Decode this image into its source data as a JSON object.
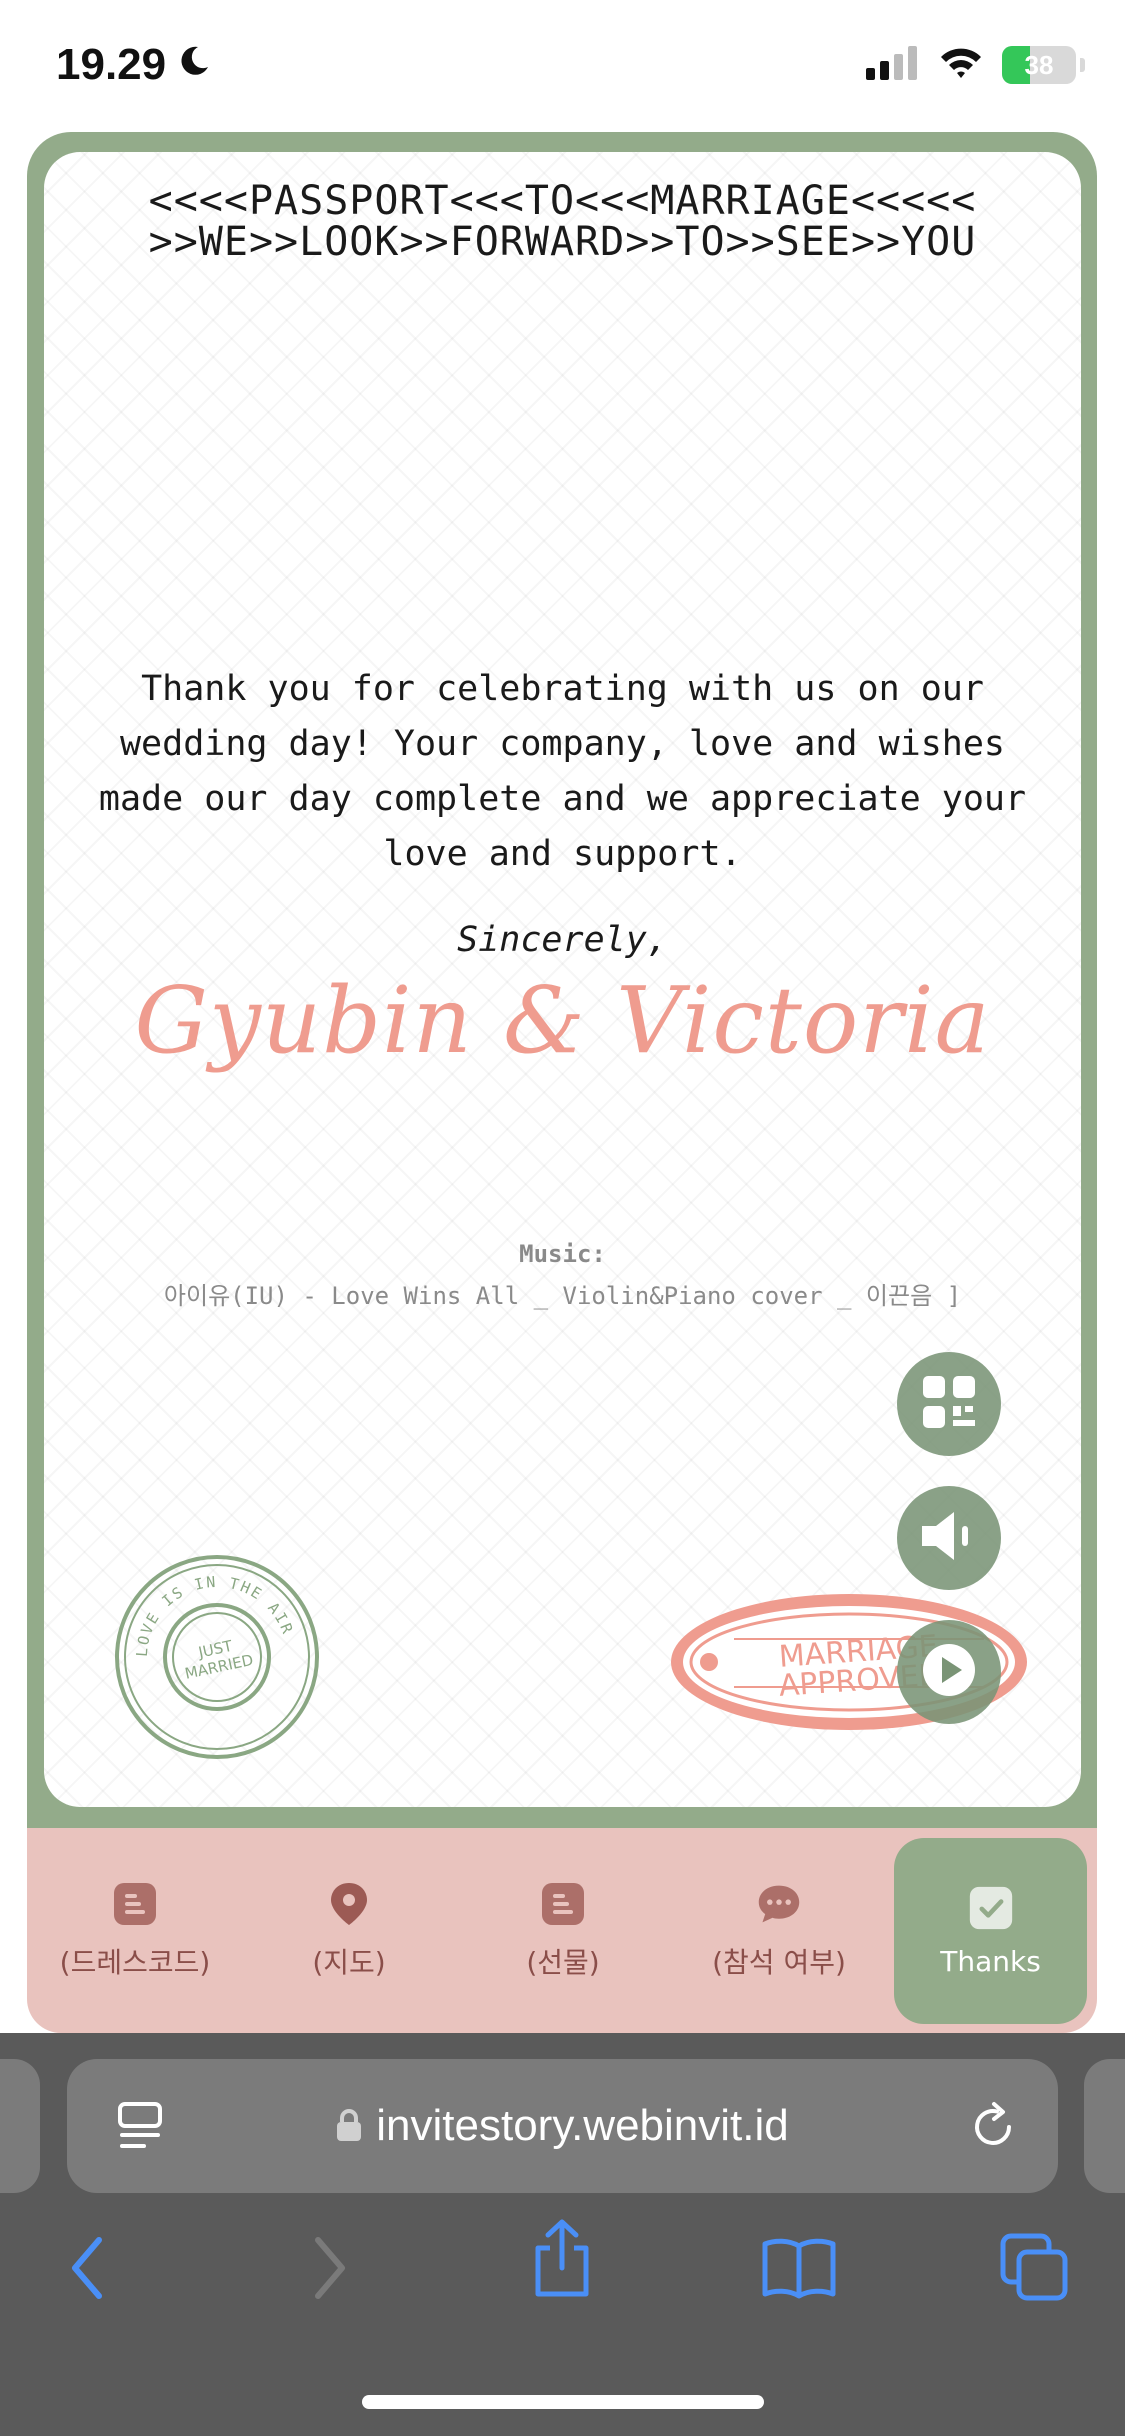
{
  "status_bar": {
    "time": "19.29",
    "focus_icon": "moon-icon",
    "signal_icon": "cellular-signal-icon",
    "wifi_icon": "wifi-icon",
    "battery_percent": "38",
    "battery_level": 0.38,
    "battery_color": "#34c759"
  },
  "card": {
    "mrz_line_1": "<<<<PASSPORT<<<TO<<<MARRIAGE<<<<<",
    "mrz_line_2": ">>WE>>LOOK>>FORWARD>>TO>>SEE>>YOU",
    "message": "Thank you for celebrating with us on our wedding day! Your company, love and wishes made our day complete and we appreciate your love and support.",
    "sincerely": "Sincerely,",
    "names": "Gyubin & Victoria",
    "music_label": "Music:",
    "music_title": "아이유(IU) - Love Wins All _ Violin&Piano cover _ 이끈음 ]"
  },
  "stamps": {
    "round_ring_text": "LOVE IS IN THE AIR",
    "round_center_line1": "JUST",
    "round_center_line2": "MARRIED",
    "oval_line1": "MARRIAGE",
    "oval_line2": "APPROVED"
  },
  "floating_buttons": [
    {
      "icon": "qr-code-icon"
    },
    {
      "icon": "speaker-icon"
    },
    {
      "icon": "play-icon"
    }
  ],
  "tabs": [
    {
      "label": "(드레스코드)",
      "icon": "document-icon"
    },
    {
      "label": "(지도)",
      "icon": "location-pin-icon"
    },
    {
      "label": "(선물)",
      "icon": "document-icon"
    },
    {
      "label": "(참석 여부)",
      "icon": "chat-bubble-icon"
    },
    {
      "label": "Thanks",
      "icon": "checkbox-icon",
      "active": true
    }
  ],
  "browser": {
    "url": "invitestory.webinvit.id",
    "lock_icon": "lock-icon",
    "reader_icon": "page-menu-icon",
    "reload_icon": "reload-icon",
    "toolbar": [
      "back-icon",
      "forward-icon",
      "share-icon",
      "bookmarks-icon",
      "tabs-icon"
    ]
  },
  "colors": {
    "accent_green": "#93ab8a",
    "tab_bar_pink": "#e9c3be",
    "names_pink": "#ef9c8f",
    "safari_blue": "#4a8ff7"
  }
}
